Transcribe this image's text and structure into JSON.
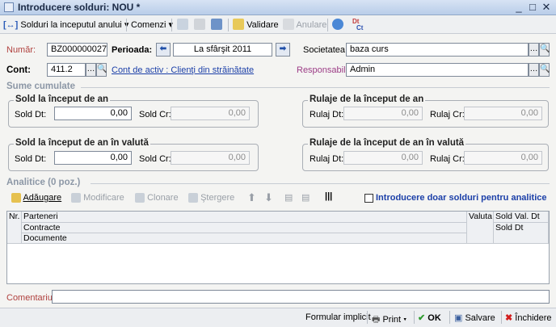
{
  "window": {
    "title": "Introducere solduri: NOU *"
  },
  "toolbar": {
    "solduri_label": "Solduri la inceputul anului",
    "comenzi_label": "Comenzi",
    "validare_label": "Validare",
    "anulare_label": "Anulare",
    "dtct_top": "Dt",
    "dtct_bottom": "Ct"
  },
  "header": {
    "numar_label": "Număr:",
    "numar_value": "BZ000000027",
    "perioada_label": "Perioada:",
    "perioada_value": "La sfârşit 2011",
    "societatea_label": "Societatea:",
    "societatea_value": "baza curs",
    "cont_label": "Cont:",
    "cont_value": "411.2",
    "cont_link": "Cont de activ : Clienţi din străinătate",
    "responsabil_label": "Responsabil:",
    "responsabil_value": "Admin"
  },
  "sume": {
    "section_title": "Sume cumulate",
    "sold_an_title": "Sold la început de an",
    "sold_an_dt_label": "Sold Dt:",
    "sold_an_dt_value": "0,00",
    "sold_an_cr_label": "Sold Cr:",
    "sold_an_cr_value": "0,00",
    "rulaje_an_title": "Rulaje de la început de an",
    "rulaje_an_dt_label": "Rulaj Dt:",
    "rulaje_an_dt_value": "0,00",
    "rulaje_an_cr_label": "Rulaj Cr:",
    "rulaje_an_cr_value": "0,00",
    "sold_valuta_title": "Sold la început de an în valută",
    "sold_valuta_dt_label": "Sold Dt:",
    "sold_valuta_dt_value": "0,00",
    "sold_valuta_cr_label": "Sold Cr:",
    "sold_valuta_cr_value": "0,00",
    "rulaje_valuta_title": "Rulaje de la început de an în valută",
    "rulaje_valuta_dt_label": "Rulaj Dt:",
    "rulaje_valuta_dt_value": "0,00",
    "rulaje_valuta_cr_label": "Rulaj Cr:",
    "rulaje_valuta_cr_value": "0,00"
  },
  "analitice": {
    "section_title": "Analitice (0 poz.)",
    "adaugare": "Adăugare",
    "modificare": "Modificare",
    "clonare": "Clonare",
    "stergere": "Ştergere",
    "checkbox_label": "Introducere doar solduri pentru analitice",
    "columns": {
      "nr": "Nr.",
      "parteneri": "Parteneri",
      "contracte": "Contracte",
      "documente": "Documente",
      "valuta": "Valuta",
      "sold_val_dt": "Sold Val. Dt",
      "sold_dt": "Sold Dt"
    }
  },
  "comentariu": {
    "label": "Comentariu:",
    "value": ""
  },
  "statusbar": {
    "formular": "Formular implicit",
    "print": "Print",
    "ok": "OK",
    "salvare": "Salvare",
    "inchidere": "Închidere"
  }
}
